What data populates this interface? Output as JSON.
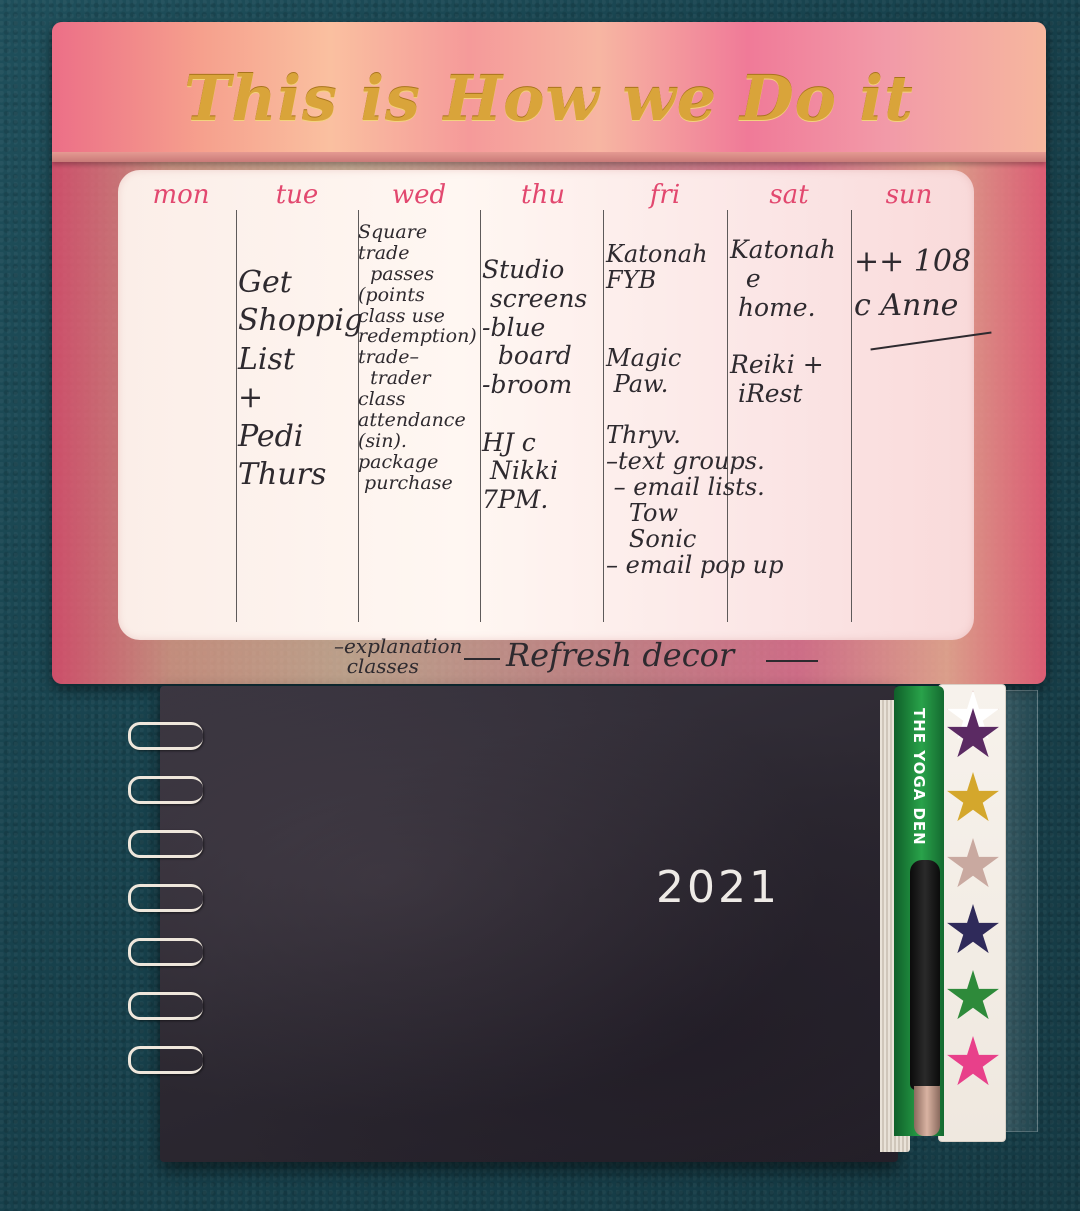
{
  "header": {
    "title": "This is How we Do it"
  },
  "days": [
    "mon",
    "tue",
    "wed",
    "thu",
    "fri",
    "sat",
    "sun"
  ],
  "notes": {
    "tue": "Get\nShoppig\nList\n+\nPedi\nThurs",
    "wed": "Square\ntrade\n  passes\n(points\nclass use\nredemption)\ntrade–\n  trader\nclass\nattendance\n(sin).\npackage\n purchase",
    "thu": "Studio\n screens\n-blue\n  board\n-broom\n\nHJ c\n Nikki\n7PM.",
    "fri": "Katonah\nFYB\n\n\nMagic\n Paw.\n\nThryv.\n–text groups.\n – email lists.\n   Tow\n   Sonic\n– email pop up",
    "sat": "Katonah\n  e\n home.\n\nReiki +\n iRest",
    "sun": "++ 108\nc Anne"
  },
  "footer": {
    "explanation": "–explanation\n  classes",
    "refresh": "Refresh decor"
  },
  "notebook": {
    "year": "2021"
  },
  "pen": {
    "brand": "THE YOGA DEN"
  },
  "colors": {
    "day_label": "#e2486f",
    "title_gold": "#d9a43a",
    "ink": "#2e2a2f",
    "background": "#1f4f5b"
  },
  "stickers": {
    "stars": [
      "#ffffff",
      "#5b2a63",
      "#d4a72c",
      "#c9a9a0",
      "#2f2a5a",
      "#2e8a3a",
      "#e8408a"
    ]
  }
}
